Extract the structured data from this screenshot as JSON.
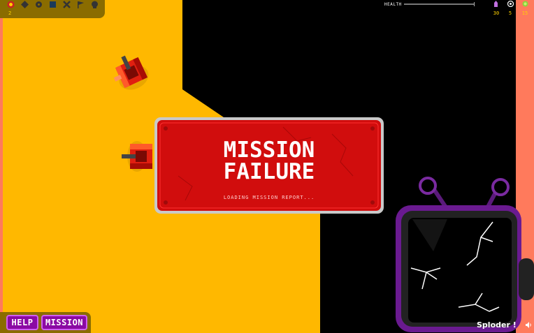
{
  "hud": {
    "inventory_icons": [
      "target-badge-icon",
      "diamond-icon",
      "gear-icon",
      "square-icon",
      "cross-icon",
      "flag-icon",
      "skull-icon"
    ],
    "inventory_count": "2",
    "health_label": "HEALTH",
    "health_value": 1.0,
    "stats": [
      {
        "icon": "enemy-icon",
        "value": "30"
      },
      {
        "icon": "target-icon",
        "value": "5"
      },
      {
        "icon": "coin-icon",
        "value": "15"
      }
    ]
  },
  "modal": {
    "title_line1": "MISSION",
    "title_line2": "FAILURE",
    "subtitle": "LOADING MISSION REPORT..."
  },
  "buttons": {
    "help": "HELP",
    "mission": "MISSION"
  },
  "footer": {
    "brand": "Sploder !",
    "sound_icon": "speaker-icon"
  },
  "colors": {
    "ground": "#ffb800",
    "void": "#000000",
    "wall_edge": "#ff7a5c",
    "modal_red": "#d10d0d",
    "button_purple": "#8b0aa3"
  }
}
